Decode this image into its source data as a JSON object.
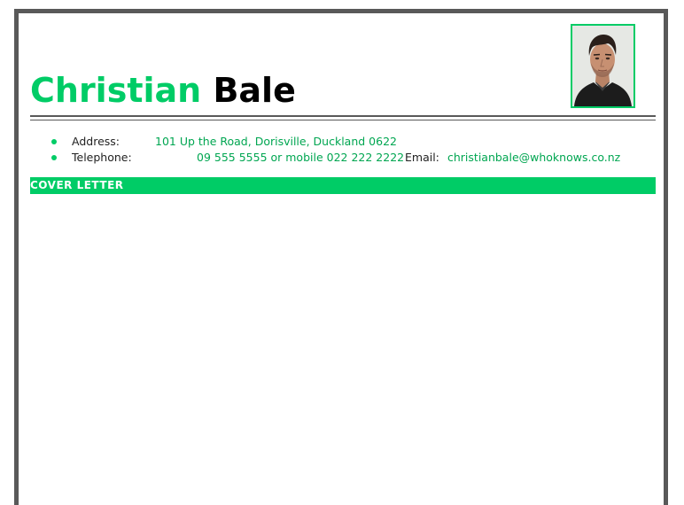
{
  "header": {
    "first_name": "Christian",
    "last_name": "Bale"
  },
  "contact": {
    "address_label": "Address:",
    "address_value": "101 Up the Road, Dorisville, Duckland 0622",
    "telephone_label": "Telephone:",
    "telephone_value": "09 555 5555 or mobile 022 222 2222",
    "email_label": "Email:",
    "email_value": "christianbale@whoknows.co.nz"
  },
  "section": {
    "title": "COVER LETTER"
  },
  "colors": {
    "accent": "#00cc66",
    "frame": "#595959",
    "link_text": "#00a651"
  }
}
